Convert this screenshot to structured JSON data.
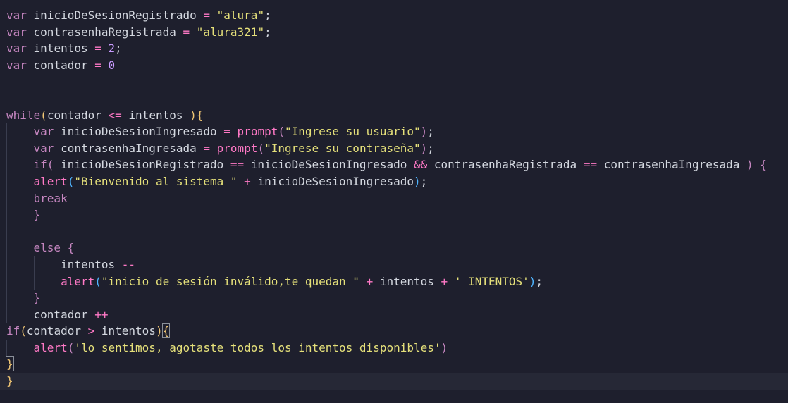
{
  "editor": {
    "language": "javascript",
    "current_line_index": 22,
    "lines": [
      {
        "indent": 0,
        "tokens": [
          [
            "kw",
            "var"
          ],
          [
            "id",
            " inicioDeSesionRegistrado "
          ],
          [
            "op",
            "="
          ],
          [
            "p",
            " "
          ],
          [
            "str",
            "\"alura\""
          ],
          [
            "p",
            ";"
          ]
        ]
      },
      {
        "indent": 0,
        "tokens": [
          [
            "kw",
            "var"
          ],
          [
            "id",
            " contrasenhaRegistrada "
          ],
          [
            "op",
            "="
          ],
          [
            "p",
            " "
          ],
          [
            "str",
            "\"alura321\""
          ],
          [
            "p",
            ";"
          ]
        ]
      },
      {
        "indent": 0,
        "tokens": [
          [
            "kw",
            "var"
          ],
          [
            "id",
            " intentos "
          ],
          [
            "op",
            "="
          ],
          [
            "p",
            " "
          ],
          [
            "num",
            "2"
          ],
          [
            "p",
            ";"
          ]
        ]
      },
      {
        "indent": 0,
        "tokens": [
          [
            "kw",
            "var"
          ],
          [
            "id",
            " contador "
          ],
          [
            "op",
            "="
          ],
          [
            "p",
            " "
          ],
          [
            "num",
            "0"
          ]
        ]
      },
      {
        "indent": 0,
        "tokens": []
      },
      {
        "indent": 0,
        "tokens": []
      },
      {
        "indent": 0,
        "tokens": [
          [
            "kw",
            "while"
          ],
          [
            "b1",
            "("
          ],
          [
            "id",
            "contador "
          ],
          [
            "op",
            "<="
          ],
          [
            "id",
            " intentos "
          ],
          [
            "b1",
            ")"
          ],
          [
            "b1",
            "{"
          ]
        ]
      },
      {
        "indent": 1,
        "tokens": [
          [
            "kw",
            "var"
          ],
          [
            "id",
            " inicioDeSesionIngresado "
          ],
          [
            "op",
            "="
          ],
          [
            "p",
            " "
          ],
          [
            "fn",
            "prompt"
          ],
          [
            "b2",
            "("
          ],
          [
            "str",
            "\"Ingrese su usuario\""
          ],
          [
            "b2",
            ")"
          ],
          [
            "p",
            ";"
          ]
        ]
      },
      {
        "indent": 1,
        "tokens": [
          [
            "kw",
            "var"
          ],
          [
            "id",
            " contrasenhaIngresada "
          ],
          [
            "op",
            "="
          ],
          [
            "p",
            " "
          ],
          [
            "fn",
            "prompt"
          ],
          [
            "b2",
            "("
          ],
          [
            "str",
            "\"Ingrese su contraseña\""
          ],
          [
            "b2",
            ")"
          ],
          [
            "p",
            ";"
          ]
        ]
      },
      {
        "indent": 1,
        "tokens": [
          [
            "kw",
            "if"
          ],
          [
            "b2",
            "("
          ],
          [
            "id",
            " inicioDeSesionRegistrado "
          ],
          [
            "op",
            "=="
          ],
          [
            "id",
            " inicioDeSesionIngresado "
          ],
          [
            "op",
            "&&"
          ],
          [
            "id",
            " contrasenhaRegistrada "
          ],
          [
            "op",
            "=="
          ],
          [
            "id",
            " contrasenhaIngresada "
          ],
          [
            "b2",
            ")"
          ],
          [
            "p",
            " "
          ],
          [
            "b2",
            "{"
          ]
        ]
      },
      {
        "indent": 1,
        "tokens": [
          [
            "fn",
            "alert"
          ],
          [
            "b3",
            "("
          ],
          [
            "str",
            "\"Bienvenido al sistema \""
          ],
          [
            "p",
            " "
          ],
          [
            "op",
            "+"
          ],
          [
            "id",
            " inicioDeSesionIngresado"
          ],
          [
            "b3",
            ")"
          ],
          [
            "p",
            ";"
          ]
        ]
      },
      {
        "indent": 1,
        "tokens": [
          [
            "kw",
            "break"
          ]
        ]
      },
      {
        "indent": 1,
        "tokens": [
          [
            "b2",
            "}"
          ]
        ]
      },
      {
        "indent": 1,
        "tokens": []
      },
      {
        "indent": 1,
        "tokens": [
          [
            "kw",
            "else"
          ],
          [
            "p",
            " "
          ],
          [
            "b2",
            "{"
          ]
        ]
      },
      {
        "indent": 2,
        "tokens": [
          [
            "id",
            "intentos "
          ],
          [
            "op",
            "--"
          ]
        ]
      },
      {
        "indent": 2,
        "tokens": [
          [
            "fn",
            "alert"
          ],
          [
            "b3",
            "("
          ],
          [
            "str",
            "\"inicio de sesión inválido,te quedan \""
          ],
          [
            "p",
            " "
          ],
          [
            "op",
            "+"
          ],
          [
            "id",
            " intentos "
          ],
          [
            "op",
            "+"
          ],
          [
            "p",
            " "
          ],
          [
            "str",
            "' INTENTOS'"
          ],
          [
            "b3",
            ")"
          ],
          [
            "p",
            ";"
          ]
        ]
      },
      {
        "indent": 1,
        "tokens": [
          [
            "b2",
            "}"
          ]
        ]
      },
      {
        "indent": 1,
        "tokens": [
          [
            "id",
            "contador "
          ],
          [
            "op",
            "++"
          ]
        ]
      },
      {
        "indent": 0,
        "tokens": [
          [
            "kw",
            "if"
          ],
          [
            "b1",
            "("
          ],
          [
            "id",
            "contador "
          ],
          [
            "op",
            ">"
          ],
          [
            "id",
            " intentos"
          ],
          [
            "b1",
            ")"
          ],
          [
            "b1",
            "{",
            "bm"
          ]
        ]
      },
      {
        "indent": 1,
        "tokens": [
          [
            "fn",
            "alert"
          ],
          [
            "b2",
            "("
          ],
          [
            "str",
            "'lo sentimos, agotaste todos los intentos disponibles'"
          ],
          [
            "b2",
            ")"
          ]
        ]
      },
      {
        "indent": 0,
        "tokens": [
          [
            "b1",
            "}",
            "bm"
          ]
        ]
      },
      {
        "indent": 0,
        "tokens": [
          [
            "b1",
            "}"
          ]
        ]
      }
    ]
  }
}
